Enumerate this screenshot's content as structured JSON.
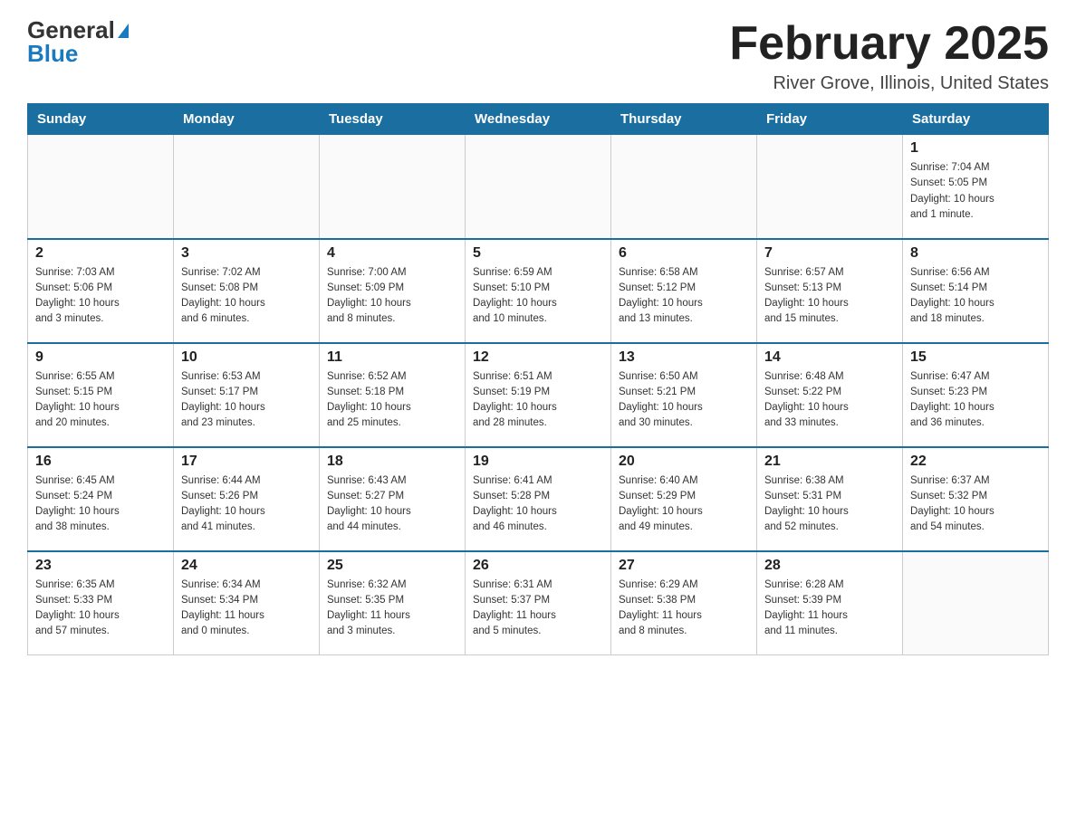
{
  "logo": {
    "text_general": "General",
    "text_blue": "Blue"
  },
  "title": "February 2025",
  "subtitle": "River Grove, Illinois, United States",
  "weekdays": [
    "Sunday",
    "Monday",
    "Tuesday",
    "Wednesday",
    "Thursday",
    "Friday",
    "Saturday"
  ],
  "weeks": [
    [
      {
        "day": "",
        "info": ""
      },
      {
        "day": "",
        "info": ""
      },
      {
        "day": "",
        "info": ""
      },
      {
        "day": "",
        "info": ""
      },
      {
        "day": "",
        "info": ""
      },
      {
        "day": "",
        "info": ""
      },
      {
        "day": "1",
        "info": "Sunrise: 7:04 AM\nSunset: 5:05 PM\nDaylight: 10 hours\nand 1 minute."
      }
    ],
    [
      {
        "day": "2",
        "info": "Sunrise: 7:03 AM\nSunset: 5:06 PM\nDaylight: 10 hours\nand 3 minutes."
      },
      {
        "day": "3",
        "info": "Sunrise: 7:02 AM\nSunset: 5:08 PM\nDaylight: 10 hours\nand 6 minutes."
      },
      {
        "day": "4",
        "info": "Sunrise: 7:00 AM\nSunset: 5:09 PM\nDaylight: 10 hours\nand 8 minutes."
      },
      {
        "day": "5",
        "info": "Sunrise: 6:59 AM\nSunset: 5:10 PM\nDaylight: 10 hours\nand 10 minutes."
      },
      {
        "day": "6",
        "info": "Sunrise: 6:58 AM\nSunset: 5:12 PM\nDaylight: 10 hours\nand 13 minutes."
      },
      {
        "day": "7",
        "info": "Sunrise: 6:57 AM\nSunset: 5:13 PM\nDaylight: 10 hours\nand 15 minutes."
      },
      {
        "day": "8",
        "info": "Sunrise: 6:56 AM\nSunset: 5:14 PM\nDaylight: 10 hours\nand 18 minutes."
      }
    ],
    [
      {
        "day": "9",
        "info": "Sunrise: 6:55 AM\nSunset: 5:15 PM\nDaylight: 10 hours\nand 20 minutes."
      },
      {
        "day": "10",
        "info": "Sunrise: 6:53 AM\nSunset: 5:17 PM\nDaylight: 10 hours\nand 23 minutes."
      },
      {
        "day": "11",
        "info": "Sunrise: 6:52 AM\nSunset: 5:18 PM\nDaylight: 10 hours\nand 25 minutes."
      },
      {
        "day": "12",
        "info": "Sunrise: 6:51 AM\nSunset: 5:19 PM\nDaylight: 10 hours\nand 28 minutes."
      },
      {
        "day": "13",
        "info": "Sunrise: 6:50 AM\nSunset: 5:21 PM\nDaylight: 10 hours\nand 30 minutes."
      },
      {
        "day": "14",
        "info": "Sunrise: 6:48 AM\nSunset: 5:22 PM\nDaylight: 10 hours\nand 33 minutes."
      },
      {
        "day": "15",
        "info": "Sunrise: 6:47 AM\nSunset: 5:23 PM\nDaylight: 10 hours\nand 36 minutes."
      }
    ],
    [
      {
        "day": "16",
        "info": "Sunrise: 6:45 AM\nSunset: 5:24 PM\nDaylight: 10 hours\nand 38 minutes."
      },
      {
        "day": "17",
        "info": "Sunrise: 6:44 AM\nSunset: 5:26 PM\nDaylight: 10 hours\nand 41 minutes."
      },
      {
        "day": "18",
        "info": "Sunrise: 6:43 AM\nSunset: 5:27 PM\nDaylight: 10 hours\nand 44 minutes."
      },
      {
        "day": "19",
        "info": "Sunrise: 6:41 AM\nSunset: 5:28 PM\nDaylight: 10 hours\nand 46 minutes."
      },
      {
        "day": "20",
        "info": "Sunrise: 6:40 AM\nSunset: 5:29 PM\nDaylight: 10 hours\nand 49 minutes."
      },
      {
        "day": "21",
        "info": "Sunrise: 6:38 AM\nSunset: 5:31 PM\nDaylight: 10 hours\nand 52 minutes."
      },
      {
        "day": "22",
        "info": "Sunrise: 6:37 AM\nSunset: 5:32 PM\nDaylight: 10 hours\nand 54 minutes."
      }
    ],
    [
      {
        "day": "23",
        "info": "Sunrise: 6:35 AM\nSunset: 5:33 PM\nDaylight: 10 hours\nand 57 minutes."
      },
      {
        "day": "24",
        "info": "Sunrise: 6:34 AM\nSunset: 5:34 PM\nDaylight: 11 hours\nand 0 minutes."
      },
      {
        "day": "25",
        "info": "Sunrise: 6:32 AM\nSunset: 5:35 PM\nDaylight: 11 hours\nand 3 minutes."
      },
      {
        "day": "26",
        "info": "Sunrise: 6:31 AM\nSunset: 5:37 PM\nDaylight: 11 hours\nand 5 minutes."
      },
      {
        "day": "27",
        "info": "Sunrise: 6:29 AM\nSunset: 5:38 PM\nDaylight: 11 hours\nand 8 minutes."
      },
      {
        "day": "28",
        "info": "Sunrise: 6:28 AM\nSunset: 5:39 PM\nDaylight: 11 hours\nand 11 minutes."
      },
      {
        "day": "",
        "info": ""
      }
    ]
  ]
}
